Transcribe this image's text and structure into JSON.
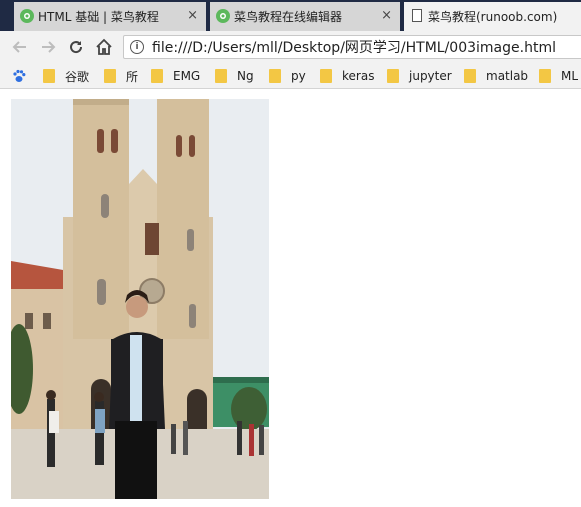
{
  "tabs": [
    {
      "title": "HTML 基础 | 菜鸟教程",
      "active": false,
      "icon": "runoob-icon"
    },
    {
      "title": "菜鸟教程在线编辑器",
      "active": false,
      "icon": "runoob-icon"
    },
    {
      "title": "菜鸟教程(runoob.com)",
      "active": true,
      "icon": "page-icon"
    }
  ],
  "close_glyph": "×",
  "toolbar": {
    "url": "file:///D:/Users/mll/Desktop/网页学习/HTML/003image.html",
    "info_glyph": "i"
  },
  "bookmarks": [
    {
      "label": "谷歌"
    },
    {
      "label": "所"
    },
    {
      "label": "EMG"
    },
    {
      "label": "Ng"
    },
    {
      "label": "py"
    },
    {
      "label": "keras"
    },
    {
      "label": "jupyter"
    },
    {
      "label": "matlab"
    },
    {
      "label": "ML"
    }
  ],
  "colors": {
    "tabstrip": "#1f2a44",
    "folder": "#f3c744",
    "favicon": "#5cb85c"
  }
}
